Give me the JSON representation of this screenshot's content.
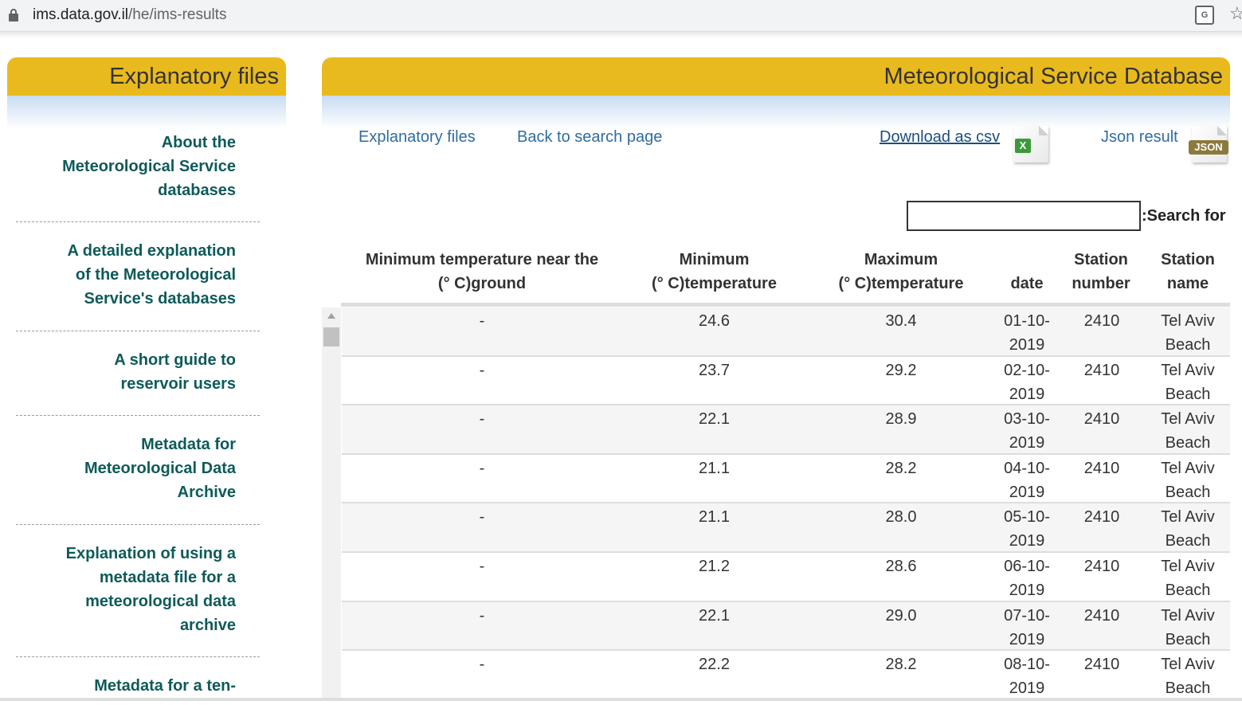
{
  "browser": {
    "url_host": "ims.data.gov.il",
    "url_path": "/he/ims-results"
  },
  "sidebar": {
    "title": "Explanatory files",
    "items": [
      {
        "lines": [
          "About the",
          "Meteorological Service",
          "databases"
        ]
      },
      {
        "lines": [
          "A detailed explanation",
          "of the Meteorological",
          "Service's databases"
        ]
      },
      {
        "lines": [
          "A short guide to",
          "reservoir users"
        ]
      },
      {
        "lines": [
          "Metadata for",
          "Meteorological Data",
          "Archive"
        ]
      },
      {
        "lines": [
          "Explanation of using a",
          "metadata file for a",
          "meteorological data",
          "archive"
        ]
      },
      {
        "lines": [
          "Metadata for a ten-"
        ]
      }
    ]
  },
  "main": {
    "title": "Meteorological Service Database",
    "links": {
      "explanatory": "Explanatory files",
      "back": "Back to search page",
      "csv": "Download as csv",
      "json": "Json result"
    },
    "icons": {
      "csv_badge": "X",
      "json_badge": "JSON"
    },
    "search": {
      "label": ":Search for",
      "value": ""
    }
  },
  "table": {
    "headers": {
      "ground": [
        "Minimum temperature near the",
        "(° C)ground"
      ],
      "min": [
        "Minimum",
        "(° C)temperature"
      ],
      "max": [
        "Maximum",
        "(° C)temperature"
      ],
      "date": [
        "date"
      ],
      "number": [
        "Station",
        "number"
      ],
      "name": [
        "Station",
        "name"
      ]
    },
    "rows": [
      {
        "ground": "-",
        "min": "24.6",
        "max": "30.4",
        "date": [
          "01-10-",
          "2019"
        ],
        "number": "2410",
        "name": [
          "Tel Aviv",
          "Beach"
        ]
      },
      {
        "ground": "-",
        "min": "23.7",
        "max": "29.2",
        "date": [
          "02-10-",
          "2019"
        ],
        "number": "2410",
        "name": [
          "Tel Aviv",
          "Beach"
        ]
      },
      {
        "ground": "-",
        "min": "22.1",
        "max": "28.9",
        "date": [
          "03-10-",
          "2019"
        ],
        "number": "2410",
        "name": [
          "Tel Aviv",
          "Beach"
        ]
      },
      {
        "ground": "-",
        "min": "21.1",
        "max": "28.2",
        "date": [
          "04-10-",
          "2019"
        ],
        "number": "2410",
        "name": [
          "Tel Aviv",
          "Beach"
        ]
      },
      {
        "ground": "-",
        "min": "21.1",
        "max": "28.0",
        "date": [
          "05-10-",
          "2019"
        ],
        "number": "2410",
        "name": [
          "Tel Aviv",
          "Beach"
        ]
      },
      {
        "ground": "-",
        "min": "21.2",
        "max": "28.6",
        "date": [
          "06-10-",
          "2019"
        ],
        "number": "2410",
        "name": [
          "Tel Aviv",
          "Beach"
        ]
      },
      {
        "ground": "-",
        "min": "22.1",
        "max": "29.0",
        "date": [
          "07-10-",
          "2019"
        ],
        "number": "2410",
        "name": [
          "Tel Aviv",
          "Beach"
        ]
      },
      {
        "ground": "-",
        "min": "22.2",
        "max": "28.2",
        "date": [
          "08-10-",
          "2019"
        ],
        "number": "2410",
        "name": [
          "Tel Aviv",
          "Beach"
        ]
      }
    ]
  },
  "colors": {
    "header_gold": "#e9ba1e",
    "sidebar_link": "#0f5a5a",
    "toolbar_link": "#2e6da4"
  }
}
